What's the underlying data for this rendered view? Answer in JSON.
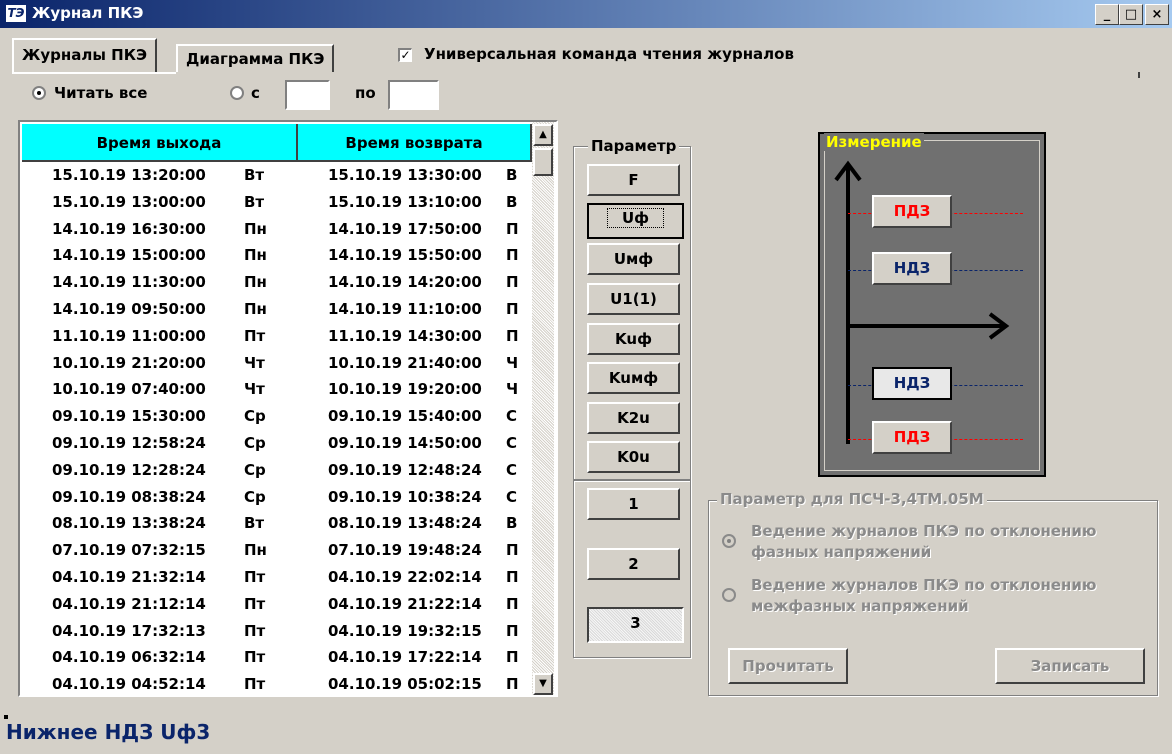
{
  "window": {
    "title": "Журнал ПКЭ",
    "minimize": "_",
    "maximize": "□",
    "close": "×",
    "app_icon": "ТЭ"
  },
  "tabs": [
    {
      "label": "Журналы ПКЭ"
    },
    {
      "label": "Диаграмма ПКЭ"
    }
  ],
  "universal_command": {
    "label": "Универсальная команда чтения журналов",
    "checked": true
  },
  "read_range": {
    "read_all_label": "Читать все",
    "from_label": "с",
    "to_label": "по",
    "from_value": "",
    "to_value": ""
  },
  "table": {
    "columns": [
      "Время выхода",
      "Время возврата"
    ],
    "rows": [
      {
        "out": "15.10.19 13:20:00",
        "out_day": "Вт",
        "ret": "15.10.19 13:30:00",
        "ret_day": "В"
      },
      {
        "out": "15.10.19 13:00:00",
        "out_day": "Вт",
        "ret": "15.10.19 13:10:00",
        "ret_day": "В"
      },
      {
        "out": "14.10.19 16:30:00",
        "out_day": "Пн",
        "ret": "14.10.19 17:50:00",
        "ret_day": "П"
      },
      {
        "out": "14.10.19 15:00:00",
        "out_day": "Пн",
        "ret": "14.10.19 15:50:00",
        "ret_day": "П"
      },
      {
        "out": "14.10.19 11:30:00",
        "out_day": "Пн",
        "ret": "14.10.19 14:20:00",
        "ret_day": "П"
      },
      {
        "out": "14.10.19 09:50:00",
        "out_day": "Пн",
        "ret": "14.10.19 11:10:00",
        "ret_day": "П"
      },
      {
        "out": "11.10.19 11:00:00",
        "out_day": "Пт",
        "ret": "11.10.19 14:30:00",
        "ret_day": "П"
      },
      {
        "out": "10.10.19 21:20:00",
        "out_day": "Чт",
        "ret": "10.10.19 21:40:00",
        "ret_day": "Ч"
      },
      {
        "out": "10.10.19 07:40:00",
        "out_day": "Чт",
        "ret": "10.10.19 19:20:00",
        "ret_day": "Ч"
      },
      {
        "out": "09.10.19 15:30:00",
        "out_day": "Ср",
        "ret": "09.10.19 15:40:00",
        "ret_day": "С"
      },
      {
        "out": "09.10.19 12:58:24",
        "out_day": "Ср",
        "ret": "09.10.19 14:50:00",
        "ret_day": "С"
      },
      {
        "out": "09.10.19 12:28:24",
        "out_day": "Ср",
        "ret": "09.10.19 12:48:24",
        "ret_day": "С"
      },
      {
        "out": "09.10.19 08:38:24",
        "out_day": "Ср",
        "ret": "09.10.19 10:38:24",
        "ret_day": "С"
      },
      {
        "out": "08.10.19 13:38:24",
        "out_day": "Вт",
        "ret": "08.10.19 13:48:24",
        "ret_day": "В"
      },
      {
        "out": "07.10.19 07:32:15",
        "out_day": "Пн",
        "ret": "07.10.19 19:48:24",
        "ret_day": "П"
      },
      {
        "out": "04.10.19 21:32:14",
        "out_day": "Пт",
        "ret": "04.10.19 22:02:14",
        "ret_day": "П"
      },
      {
        "out": "04.10.19 21:12:14",
        "out_day": "Пт",
        "ret": "04.10.19 21:22:14",
        "ret_day": "П"
      },
      {
        "out": "04.10.19 17:32:13",
        "out_day": "Пт",
        "ret": "04.10.19 19:32:15",
        "ret_day": "П"
      },
      {
        "out": "04.10.19 06:32:14",
        "out_day": "Пт",
        "ret": "04.10.19 17:22:14",
        "ret_day": "П"
      },
      {
        "out": "04.10.19 04:52:14",
        "out_day": "Пт",
        "ret": "04.10.19 05:02:15",
        "ret_day": "П"
      }
    ]
  },
  "parameter": {
    "title": "Параметр",
    "buttons": [
      "F",
      "Uф",
      "Uмф",
      "U1(1)",
      "Kuф",
      "Kuмф",
      "K2u",
      "K0u"
    ],
    "selected": "Uф",
    "phase_buttons": [
      "1",
      "2",
      "3"
    ],
    "phase_selected": "3"
  },
  "diagram": {
    "title": "Измерение",
    "upper_pdz": "ПДЗ",
    "upper_ndz": "НДЗ",
    "lower_ndz": "НДЗ",
    "lower_pdz": "ПДЗ",
    "colors": {
      "pdz": "#ff0000",
      "ndz": "#0a246a",
      "title": "#ffff00"
    }
  },
  "psch_group": {
    "title": "Параметр для ПСЧ-3,4ТМ.05М",
    "option1_line1": "Ведение журналов ПКЭ по отклонению",
    "option1_line2": "фазных напряжений",
    "option2_line1": "Ведение журналов ПКЭ по отклонению",
    "option2_line2": "межфазных напряжений",
    "read_button": "Прочитать",
    "write_button": "Записать"
  },
  "status": {
    "text": "Нижнее НДЗ Uф3"
  }
}
